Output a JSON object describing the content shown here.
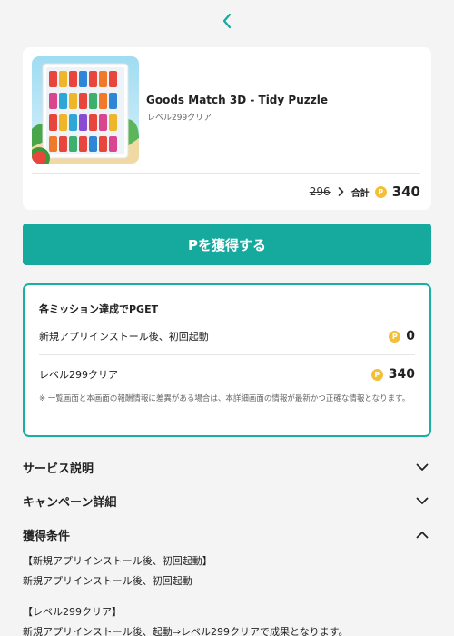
{
  "colors": {
    "accent": "#16aa9f",
    "accent_border": "#19b0a3",
    "coin": "#f3bf35"
  },
  "nav": {
    "back_icon": "chevron-left-icon"
  },
  "app": {
    "name": "Goods Match 3D - Tidy Puzzle",
    "subtitle": "レベル299クリア",
    "old_price": "296",
    "total_label": "合計",
    "coin_symbol": "P",
    "total_value": "340"
  },
  "cta": {
    "label": "Pを獲得する"
  },
  "missions": {
    "title": "各ミッション達成でPGET",
    "items": [
      {
        "label": "新規アプリインストール後、初回起動",
        "points": "0"
      },
      {
        "label": "レベル299クリア",
        "points": "340"
      }
    ],
    "note": "※ 一覧画面と本画面の報酬情報に差異がある場合は、本詳細画面の情報が最新かつ正確な情報となります。"
  },
  "accordion": [
    {
      "title": "サービス説明",
      "state": "collapsed"
    },
    {
      "title": "キャンペーン詳細",
      "state": "collapsed"
    },
    {
      "title": "獲得条件",
      "state": "expanded"
    }
  ],
  "conditions": {
    "h1": "【新規アプリインストール後、初回起動】",
    "b1": "新規アプリインストール後、初回起動",
    "h2": "【レベル299クリア】",
    "b2": "新規アプリインストール後、起動⇒レベル299クリアで成果となります。"
  }
}
